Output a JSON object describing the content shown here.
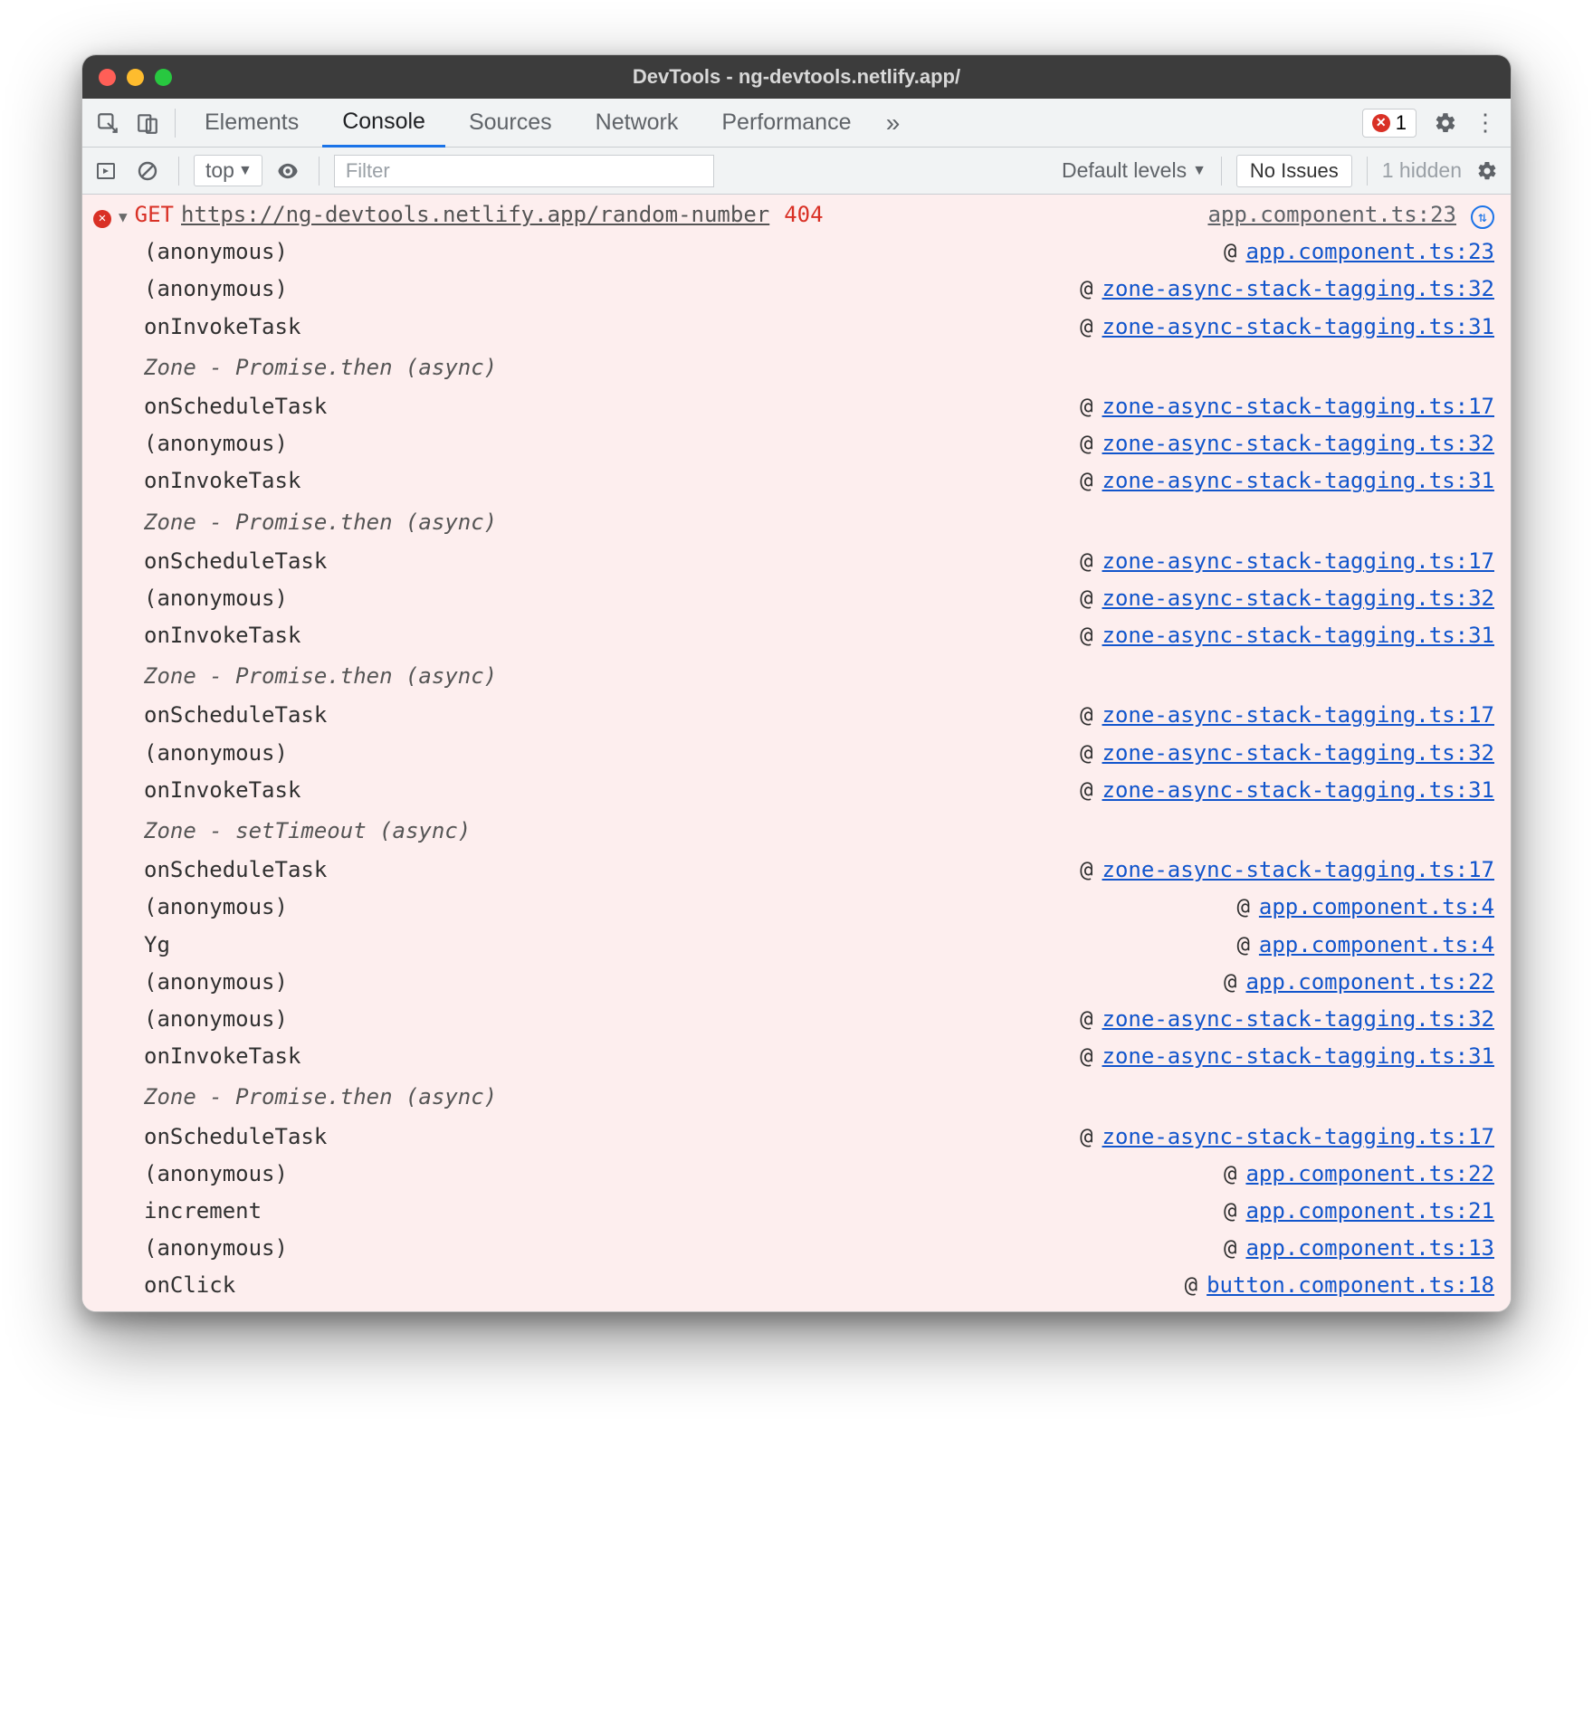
{
  "title": "DevTools - ng-devtools.netlify.app/",
  "tabs": {
    "elements": "Elements",
    "console": "Console",
    "sources": "Sources",
    "network": "Network",
    "performance": "Performance"
  },
  "errorBadge": {
    "count": "1"
  },
  "toolbar": {
    "context": "top",
    "filter_placeholder": "Filter",
    "levels": "Default levels",
    "issues": "No Issues",
    "hidden": "1 hidden"
  },
  "entry": {
    "method": "GET",
    "url": "https://ng-devtools.netlify.app/random-number",
    "status": "404",
    "source": "app.component.ts:23"
  },
  "groups": [
    {
      "header": null,
      "frames": [
        {
          "fn": "(anonymous)",
          "src": "app.component.ts:23"
        },
        {
          "fn": "(anonymous)",
          "src": "zone-async-stack-tagging.ts:32"
        },
        {
          "fn": "onInvokeTask",
          "src": "zone-async-stack-tagging.ts:31"
        }
      ]
    },
    {
      "header": "Zone - Promise.then (async)",
      "frames": [
        {
          "fn": "onScheduleTask",
          "src": "zone-async-stack-tagging.ts:17"
        },
        {
          "fn": "(anonymous)",
          "src": "zone-async-stack-tagging.ts:32"
        },
        {
          "fn": "onInvokeTask",
          "src": "zone-async-stack-tagging.ts:31"
        }
      ]
    },
    {
      "header": "Zone - Promise.then (async)",
      "frames": [
        {
          "fn": "onScheduleTask",
          "src": "zone-async-stack-tagging.ts:17"
        },
        {
          "fn": "(anonymous)",
          "src": "zone-async-stack-tagging.ts:32"
        },
        {
          "fn": "onInvokeTask",
          "src": "zone-async-stack-tagging.ts:31"
        }
      ]
    },
    {
      "header": "Zone - Promise.then (async)",
      "frames": [
        {
          "fn": "onScheduleTask",
          "src": "zone-async-stack-tagging.ts:17"
        },
        {
          "fn": "(anonymous)",
          "src": "zone-async-stack-tagging.ts:32"
        },
        {
          "fn": "onInvokeTask",
          "src": "zone-async-stack-tagging.ts:31"
        }
      ]
    },
    {
      "header": "Zone - setTimeout (async)",
      "frames": [
        {
          "fn": "onScheduleTask",
          "src": "zone-async-stack-tagging.ts:17"
        },
        {
          "fn": "(anonymous)",
          "src": "app.component.ts:4"
        },
        {
          "fn": "Yg",
          "src": "app.component.ts:4"
        },
        {
          "fn": "(anonymous)",
          "src": "app.component.ts:22"
        },
        {
          "fn": "(anonymous)",
          "src": "zone-async-stack-tagging.ts:32"
        },
        {
          "fn": "onInvokeTask",
          "src": "zone-async-stack-tagging.ts:31"
        }
      ]
    },
    {
      "header": "Zone - Promise.then (async)",
      "frames": [
        {
          "fn": "onScheduleTask",
          "src": "zone-async-stack-tagging.ts:17"
        },
        {
          "fn": "(anonymous)",
          "src": "app.component.ts:22"
        },
        {
          "fn": "increment",
          "src": "app.component.ts:21"
        },
        {
          "fn": "(anonymous)",
          "src": "app.component.ts:13"
        },
        {
          "fn": "onClick",
          "src": "button.component.ts:18"
        }
      ]
    }
  ]
}
